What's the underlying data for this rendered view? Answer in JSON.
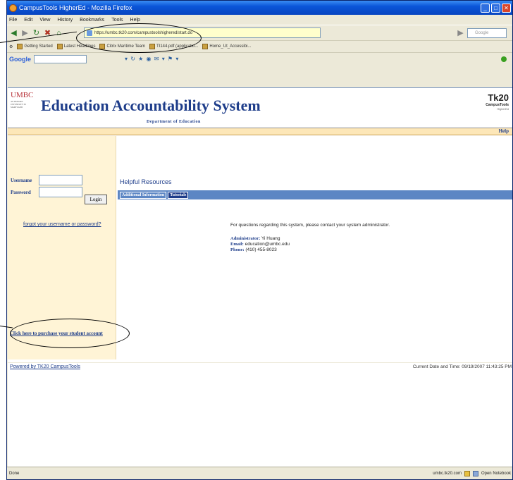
{
  "browser": {
    "title": "CampusTools HigherEd - Mozilla Firefox",
    "menu": [
      "File",
      "Edit",
      "View",
      "History",
      "Bookmarks",
      "Tools",
      "Help"
    ],
    "url": "https://umbc.tk20.com/campustoolshighered/start.do",
    "google_search_placeholder": "Google",
    "bookmarks": [
      "Getting Started",
      "Latest Headlines",
      "Citrix Maritime Team",
      "TI144.pdf (applicatio...",
      "Home_Ut_Accessibi..."
    ],
    "google_label": "Google",
    "status_left": "Done",
    "status_host": "umbc.tk20.com",
    "status_notebook": "Open Notebook"
  },
  "header": {
    "logo_text": "UMBC",
    "logo_subtext": "AN HONORS UNIVERSITY IN MARYLAND",
    "app_title": "Education Accountability System",
    "department": "Department of Education",
    "brand_tk": "Tk20",
    "brand_campustools": "CampusTools",
    "brand_highered": "HigherEd",
    "help_link": "Help"
  },
  "login": {
    "username_label": "Username",
    "password_label": "Password",
    "login_button": "Login",
    "forgot_link": "forgot your username or password?",
    "purchase_link": "Click here to purchase your student account"
  },
  "main": {
    "section_title": "Helpful Resources",
    "tabs": [
      {
        "label": "Additional Information",
        "active": true
      },
      {
        "label": "Tutorials",
        "active": false
      }
    ],
    "intro": "For questions regarding this system, please contact your system administrator.",
    "admin_label": "Administrator:",
    "admin_value": "Yi Huang",
    "email_label": "Email:",
    "email_value": "education@umbc.edu",
    "phone_label": "Phone:",
    "phone_value": "(410) 455-8023"
  },
  "footer": {
    "powered_by": "Powered by TK20 CampusTools",
    "datetime": "Current Date and Time: 09/19/2007 11:43:25 PM"
  },
  "colors": {
    "accent_blue": "#1e3d8a",
    "tab_bar": "#5c86c4",
    "sidebar_bg": "#fff4d6",
    "help_bar": "#fde7b8",
    "url_bar": "#ffffcc"
  }
}
